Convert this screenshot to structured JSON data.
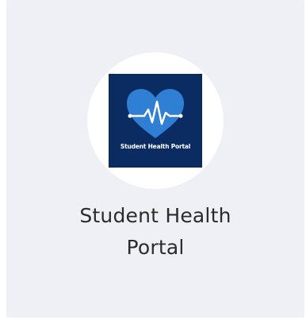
{
  "app_tile": {
    "title_line1": "Student Health",
    "title_line2": "Portal",
    "logo_text": "Student Health Portal",
    "logo_icon": "heart-heartbeat-icon",
    "colors": {
      "tile_background": "#eff0f6",
      "logo_background": "#0b2b63",
      "heart": "#2f7fd4",
      "pulse_line": "#ffffff",
      "title_text": "#2b2b2b"
    }
  }
}
